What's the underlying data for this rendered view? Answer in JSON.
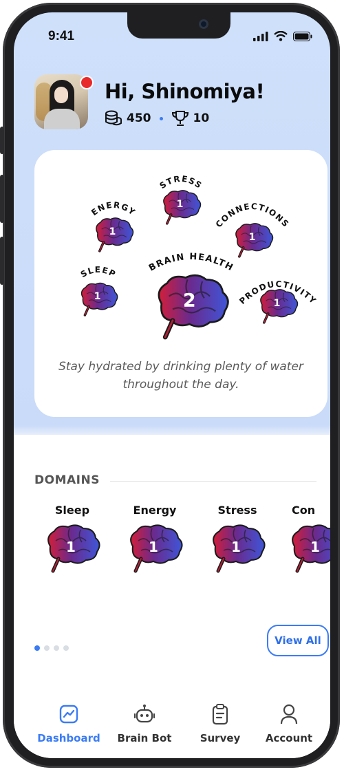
{
  "status_bar": {
    "time": "9:41"
  },
  "profile": {
    "greeting": "Hi, Shinomiya!",
    "coins": "450",
    "trophies": "10"
  },
  "brain_map": {
    "nodes": [
      {
        "label": "STRESS",
        "level": "1"
      },
      {
        "label": "ENERGY",
        "level": "1"
      },
      {
        "label": "CONNECTIONS",
        "level": "1"
      },
      {
        "label": "SLEEP",
        "level": "1"
      },
      {
        "label": "BRAIN HEALTH",
        "level": "2"
      },
      {
        "label": "PRODUCTIVITY",
        "level": "1"
      }
    ],
    "tip_line1": "Stay hydrated by drinking plenty of water",
    "tip_line2": "throughout the day."
  },
  "domains": {
    "title": "DOMAINS",
    "items": [
      {
        "label": "Sleep",
        "level": "1"
      },
      {
        "label": "Energy",
        "level": "1"
      },
      {
        "label": "Stress",
        "level": "1"
      },
      {
        "label": "Con",
        "level": "1"
      }
    ],
    "view_all_label": "View All",
    "pager": {
      "pages": 4,
      "active_index": 0
    }
  },
  "bottom_nav": {
    "items": [
      {
        "label": "Dashboard",
        "icon": "chart-icon",
        "active": true
      },
      {
        "label": "Brain Bot",
        "icon": "robot-icon",
        "active": false
      },
      {
        "label": "Survey",
        "icon": "clipboard-icon",
        "active": false
      },
      {
        "label": "Account",
        "icon": "user-icon",
        "active": false
      }
    ]
  },
  "colors": {
    "accent": "#3b7cf5",
    "background_top": "#cfe0fb",
    "notification": "#e82a2a"
  }
}
